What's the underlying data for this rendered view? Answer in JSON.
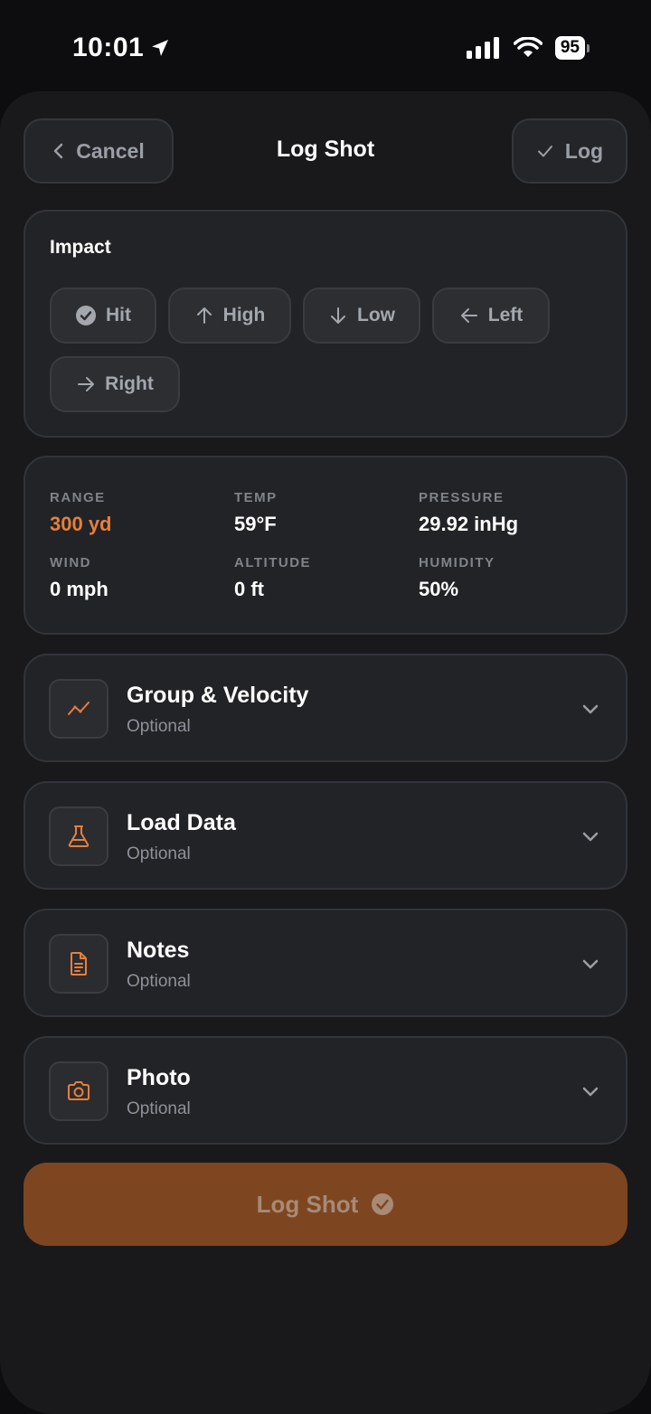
{
  "status_bar": {
    "time": "10:01",
    "battery": "95"
  },
  "header": {
    "cancel_label": "Cancel",
    "title": "Log Shot",
    "log_label": "Log"
  },
  "impact": {
    "title": "Impact",
    "options": [
      {
        "label": "Hit",
        "icon": "check-circle-icon"
      },
      {
        "label": "High",
        "icon": "arrow-up-icon"
      },
      {
        "label": "Low",
        "icon": "arrow-down-icon"
      },
      {
        "label": "Left",
        "icon": "arrow-left-icon"
      },
      {
        "label": "Right",
        "icon": "arrow-right-icon"
      }
    ]
  },
  "conditions": {
    "range": {
      "label": "RANGE",
      "value": "300 yd"
    },
    "temp": {
      "label": "TEMP",
      "value": "59°F"
    },
    "pressure": {
      "label": "PRESSURE",
      "value": "29.92 inHg"
    },
    "wind": {
      "label": "WIND",
      "value": "0 mph"
    },
    "altitude": {
      "label": "ALTITUDE",
      "value": "0 ft"
    },
    "humidity": {
      "label": "HUMIDITY",
      "value": "50%"
    }
  },
  "sections": [
    {
      "title": "Group & Velocity",
      "subtitle": "Optional",
      "icon": "chart-line-icon"
    },
    {
      "title": "Load Data",
      "subtitle": "Optional",
      "icon": "flask-icon"
    },
    {
      "title": "Notes",
      "subtitle": "Optional",
      "icon": "document-icon"
    },
    {
      "title": "Photo",
      "subtitle": "Optional",
      "icon": "camera-icon"
    }
  ],
  "submit": {
    "label": "Log Shot"
  },
  "colors": {
    "accent": "#e77f3a",
    "submit_bg": "#7d4621",
    "card_bg": "#222326",
    "sheet_bg": "#19191b"
  }
}
